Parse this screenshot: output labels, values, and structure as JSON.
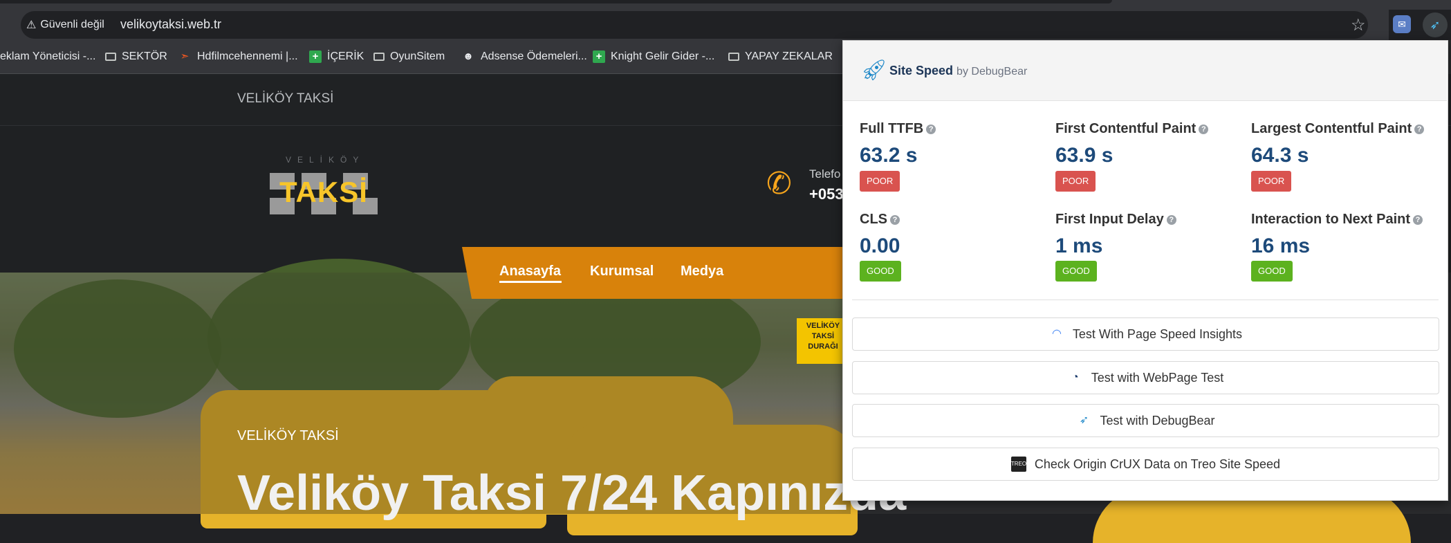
{
  "browser": {
    "security_warning": "Güvenli değil",
    "url": "velikoytaksi.web.tr",
    "bookmark_icon": "star-icon",
    "bookmarks": [
      {
        "label": "eklam Yöneticisi -...",
        "icon": "none"
      },
      {
        "label": "SEKTÖR",
        "icon": "folder-icon"
      },
      {
        "label": "Hdfilmcehennemi |...",
        "icon": "flame-icon"
      },
      {
        "label": "İÇERİK",
        "icon": "plus-icon"
      },
      {
        "label": "OyunSitem",
        "icon": "folder-icon"
      },
      {
        "label": "Adsense Ödemeleri...",
        "icon": "person-icon"
      },
      {
        "label": "Knight Gelir Gider -...",
        "icon": "plus-icon"
      },
      {
        "label": "YAPAY ZEKALAR",
        "icon": "folder-icon"
      }
    ]
  },
  "site": {
    "top_brand": "VELİKÖY TAKSİ",
    "logo_small": "VELİKÖY",
    "logo_main": "TAKSİ",
    "phone_label": "Telefo",
    "phone_number": "+053",
    "menu": [
      "Anasayfa",
      "Kurumsal",
      "Medya"
    ],
    "hero_small": "VELİKÖY TAKSİ",
    "hero_title": "Veliköy Taksi 7/24 Kapınızda",
    "sign_lines": [
      "VELİKÖY",
      "TAKSİ",
      "DURAĞI"
    ]
  },
  "popup": {
    "title": "Site Speed",
    "by": "by DebugBear",
    "metrics": [
      {
        "label": "Full TTFB",
        "value": "63.2 s",
        "rating": "POOR"
      },
      {
        "label": "First Contentful Paint",
        "value": "63.9 s",
        "rating": "POOR"
      },
      {
        "label": "Largest Contentful Paint",
        "value": "64.3 s",
        "rating": "POOR"
      },
      {
        "label": "CLS",
        "value": "0.00",
        "rating": "GOOD"
      },
      {
        "label": "First Input Delay",
        "value": "1 ms",
        "rating": "GOOD"
      },
      {
        "label": "Interaction to Next Paint",
        "value": "16 ms",
        "rating": "GOOD"
      }
    ],
    "buttons": [
      {
        "label": "Test With Page Speed Insights",
        "icon": "pagespeed-icon"
      },
      {
        "label": "Test with WebPage Test",
        "icon": "webpagetest-icon"
      },
      {
        "label": "Test with DebugBear",
        "icon": "debugbear-icon"
      },
      {
        "label": "Check Origin CrUX Data on Treo Site Speed",
        "icon": "treo-icon"
      }
    ],
    "colors": {
      "poor": "#d9534f",
      "good": "#5cb21f",
      "value": "#1d4a7a"
    }
  }
}
